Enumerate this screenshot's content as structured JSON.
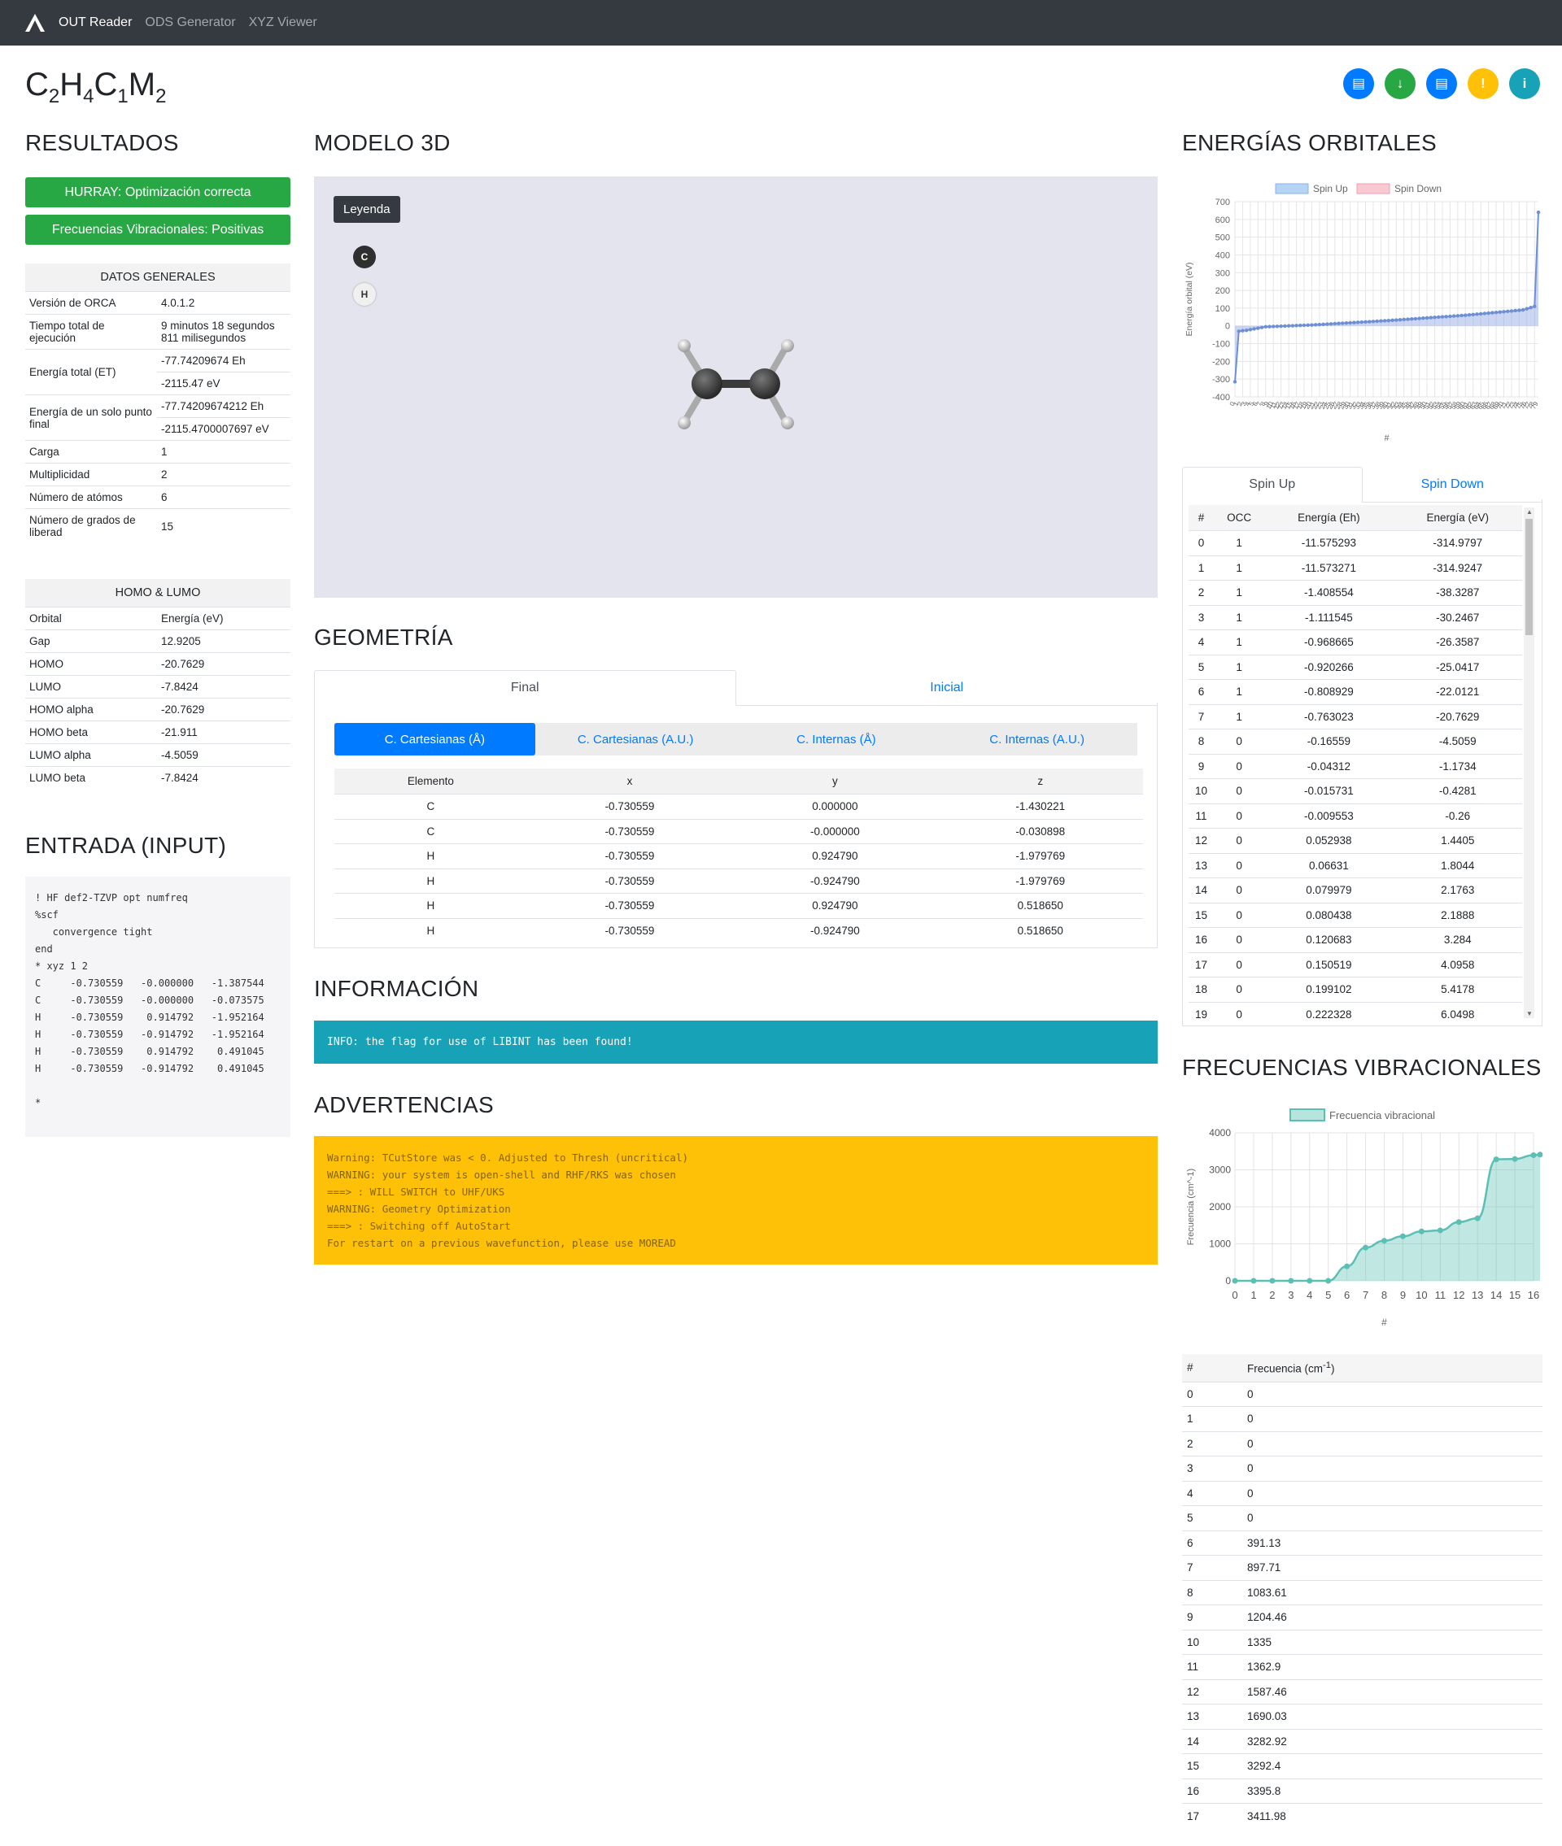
{
  "nav": {
    "brand": "OUT Reader",
    "links": [
      "ODS Generator",
      "XYZ Viewer"
    ]
  },
  "molecule": {
    "parts": [
      [
        "C",
        "2"
      ],
      [
        "H",
        "4"
      ],
      [
        "C",
        "1"
      ],
      [
        "M",
        "2"
      ]
    ]
  },
  "actions": [
    {
      "icon": "file-icon",
      "glyph": "▤",
      "color": "#007bff"
    },
    {
      "icon": "download-icon",
      "glyph": "↓",
      "color": "#28a745"
    },
    {
      "icon": "file-icon",
      "glyph": "▤",
      "color": "#007bff"
    },
    {
      "icon": "exclamation-icon",
      "glyph": "!",
      "color": "#ffc107"
    },
    {
      "icon": "info-icon",
      "glyph": "i",
      "color": "#17a2b8"
    }
  ],
  "resultados": {
    "title": "RESULTADOS",
    "alerts": [
      "HURRAY: Optimización correcta",
      "Frecuencias Vibracionales: Positivas"
    ],
    "datos_title": "DATOS GENERALES",
    "datos": [
      {
        "k": "Versión de ORCA",
        "v": [
          "4.0.1.2"
        ]
      },
      {
        "k": "Tiempo total de ejecución",
        "v": [
          "9 minutos 18 segundos 811 milisegundos"
        ]
      },
      {
        "k": "Energía total (ET)",
        "v": [
          "-77.74209674 Eh",
          "-2115.47 eV"
        ]
      },
      {
        "k": "Energía de un solo punto final",
        "v": [
          "-77.74209674212 Eh",
          "-2115.4700007697 eV"
        ]
      },
      {
        "k": "Carga",
        "v": [
          "1"
        ]
      },
      {
        "k": "Multiplicidad",
        "v": [
          "2"
        ]
      },
      {
        "k": "Número de atómos",
        "v": [
          "6"
        ]
      },
      {
        "k": "Número de grados de liberad",
        "v": [
          "15"
        ]
      }
    ],
    "homo_title": "HOMO & LUMO",
    "homo_header": [
      "Orbital",
      "Energía (eV)"
    ],
    "homo": [
      [
        "Gap",
        "12.9205"
      ],
      [
        "HOMO",
        "-20.7629"
      ],
      [
        "LUMO",
        "-7.8424"
      ],
      [
        "HOMO alpha",
        "-20.7629"
      ],
      [
        "HOMO beta",
        "-21.911"
      ],
      [
        "LUMO alpha",
        "-4.5059"
      ],
      [
        "LUMO beta",
        "-7.8424"
      ]
    ]
  },
  "entrada": {
    "title": "ENTRADA (INPUT)",
    "text": "! HF def2-TZVP opt numfreq\n%scf\n   convergence tight\nend\n* xyz 1 2\nC     -0.730559   -0.000000   -1.387544\nC     -0.730559   -0.000000   -0.073575\nH     -0.730559    0.914792   -1.952164\nH     -0.730559   -0.914792   -1.952164\nH     -0.730559    0.914792    0.491045\nH     -0.730559   -0.914792    0.491045\n\n*"
  },
  "modelo": {
    "title": "MODELO 3D",
    "legend": "Leyenda",
    "atoms": [
      "C",
      "H"
    ]
  },
  "geometria": {
    "title": "GEOMETRÍA",
    "tabs": [
      "Final",
      "Inicial"
    ],
    "pills": [
      "C. Cartesianas (Å)",
      "C. Cartesianas (A.U.)",
      "C. Internas (Å)",
      "C. Internas (A.U.)"
    ],
    "header": [
      "Elemento",
      "x",
      "y",
      "z"
    ],
    "rows": [
      [
        "C",
        "-0.730559",
        "0.000000",
        "-1.430221"
      ],
      [
        "C",
        "-0.730559",
        "-0.000000",
        "-0.030898"
      ],
      [
        "H",
        "-0.730559",
        "0.924790",
        "-1.979769"
      ],
      [
        "H",
        "-0.730559",
        "-0.924790",
        "-1.979769"
      ],
      [
        "H",
        "-0.730559",
        "0.924790",
        "0.518650"
      ],
      [
        "H",
        "-0.730559",
        "-0.924790",
        "0.518650"
      ]
    ]
  },
  "informacion": {
    "title": "INFORMACIÓN",
    "text": "INFO: the flag for use of LIBINT has been found!"
  },
  "advertencias": {
    "title": "ADVERTENCIAS",
    "text": "Warning: TCutStore was < 0. Adjusted to Thresh (uncritical)\nWARNING: your system is open-shell and RHF/RKS was chosen\n===> : WILL SWITCH to UHF/UKS\nWARNING: Geometry Optimization\n===> : Switching off AutoStart\nFor restart on a previous wavefunction, please use MOREAD"
  },
  "orbitales": {
    "title": "ENERGÍAS ORBITALES",
    "tabs": [
      "Spin Up",
      "Spin Down"
    ],
    "header": [
      "#",
      "OCC",
      "Energía (Eh)",
      "Energía (eV)"
    ],
    "rows": [
      [
        "0",
        "1",
        "-11.575293",
        "-314.9797"
      ],
      [
        "1",
        "1",
        "-11.573271",
        "-314.9247"
      ],
      [
        "2",
        "1",
        "-1.408554",
        "-38.3287"
      ],
      [
        "3",
        "1",
        "-1.111545",
        "-30.2467"
      ],
      [
        "4",
        "1",
        "-0.968665",
        "-26.3587"
      ],
      [
        "5",
        "1",
        "-0.920266",
        "-25.0417"
      ],
      [
        "6",
        "1",
        "-0.808929",
        "-22.0121"
      ],
      [
        "7",
        "1",
        "-0.763023",
        "-20.7629"
      ],
      [
        "8",
        "0",
        "-0.16559",
        "-4.5059"
      ],
      [
        "9",
        "0",
        "-0.04312",
        "-1.1734"
      ],
      [
        "10",
        "0",
        "-0.015731",
        "-0.4281"
      ],
      [
        "11",
        "0",
        "-0.009553",
        "-0.26"
      ],
      [
        "12",
        "0",
        "0.052938",
        "1.4405"
      ],
      [
        "13",
        "0",
        "0.06631",
        "1.8044"
      ],
      [
        "14",
        "0",
        "0.079979",
        "2.1763"
      ],
      [
        "15",
        "0",
        "0.080438",
        "2.1888"
      ],
      [
        "16",
        "0",
        "0.120683",
        "3.284"
      ],
      [
        "17",
        "0",
        "0.150519",
        "4.0958"
      ],
      [
        "18",
        "0",
        "0.199102",
        "5.4178"
      ],
      [
        "19",
        "0",
        "0.222328",
        "6.0498"
      ]
    ]
  },
  "frecuencias": {
    "title": "FRECUENCIAS VIBRACIONALES",
    "header": [
      "#",
      "Frecuencia (cm-1)"
    ],
    "rows": [
      [
        "0",
        "0"
      ],
      [
        "1",
        "0"
      ],
      [
        "2",
        "0"
      ],
      [
        "3",
        "0"
      ],
      [
        "4",
        "0"
      ],
      [
        "5",
        "0"
      ],
      [
        "6",
        "391.13"
      ],
      [
        "7",
        "897.71"
      ],
      [
        "8",
        "1083.61"
      ],
      [
        "9",
        "1204.46"
      ],
      [
        "10",
        "1335"
      ],
      [
        "11",
        "1362.9"
      ],
      [
        "12",
        "1587.46"
      ],
      [
        "13",
        "1690.03"
      ],
      [
        "14",
        "3282.92"
      ],
      [
        "15",
        "3292.4"
      ],
      [
        "16",
        "3395.8"
      ],
      [
        "17",
        "3411.98"
      ]
    ]
  },
  "chart_data": [
    {
      "type": "line",
      "legend": [
        "Spin Up",
        "Spin Down"
      ],
      "legend_position": "top",
      "xlabel": "#",
      "ylabel": "Energía orbital (eV)",
      "ylim": [
        -400,
        700
      ],
      "yticks": [
        700,
        600,
        500,
        400,
        300,
        200,
        100,
        0,
        -100,
        -200,
        -300,
        -400
      ],
      "grid": true,
      "colors": {
        "Spin Up": "#6e8fd6",
        "Spin Down": "#f4a0b0"
      },
      "series": [
        {
          "name": "Spin Up",
          "x_count": 80,
          "values_sample": [
            {
              "x": 0,
              "y": -315
            },
            {
              "x": 1,
              "y": -30
            },
            {
              "x": 3,
              "y": -25
            },
            {
              "x": 8,
              "y": -5
            },
            {
              "x": 20,
              "y": 5
            },
            {
              "x": 40,
              "y": 30
            },
            {
              "x": 60,
              "y": 60
            },
            {
              "x": 75,
              "y": 90
            },
            {
              "x": 78,
              "y": 110
            },
            {
              "x": 79,
              "y": 640
            }
          ]
        }
      ]
    },
    {
      "type": "area",
      "legend": [
        "Frecuencia vibracional"
      ],
      "legend_position": "top",
      "xlabel": "#",
      "ylabel": "Frecuencia (cm^-1)",
      "ylim": [
        0,
        4000
      ],
      "yticks": [
        4000,
        3000,
        2000,
        1000,
        0
      ],
      "grid": true,
      "colors": {
        "Frecuencia vibracional": "#5bbfb5"
      },
      "x": [
        0,
        1,
        2,
        3,
        4,
        5,
        6,
        7,
        8,
        9,
        10,
        11,
        12,
        13,
        14,
        15,
        16,
        17
      ],
      "series": [
        {
          "name": "Frecuencia vibracional",
          "values": [
            0,
            0,
            0,
            0,
            0,
            0,
            391.13,
            897.71,
            1083.61,
            1204.46,
            1335,
            1362.9,
            1587.46,
            1690.03,
            3282.92,
            3292.4,
            3395.8,
            3411.98
          ]
        }
      ]
    }
  ]
}
